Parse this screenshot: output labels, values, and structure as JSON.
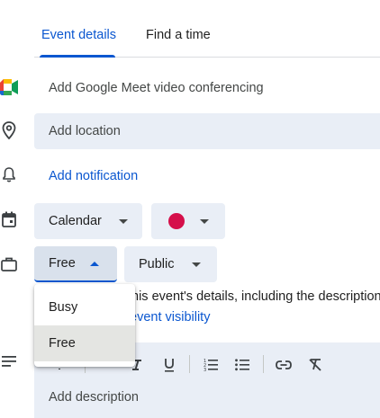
{
  "tabs": [
    {
      "label": "Event details"
    },
    {
      "label": "Find a time"
    }
  ],
  "meet": {
    "label": "Add Google Meet video conferencing"
  },
  "location": {
    "placeholder": "Add location"
  },
  "notification": {
    "label": "Add notification"
  },
  "calendar": {
    "label": "Calendar",
    "color": "#d50f4a"
  },
  "availability": {
    "label": "Free"
  },
  "visibility": {
    "label": "Public"
  },
  "visibility_note": {
    "text": "his event's details, including the description",
    "link": "event visibility"
  },
  "availability_menu": {
    "options": [
      {
        "label": "Busy"
      },
      {
        "label": "Free"
      }
    ],
    "selected": "Free"
  },
  "description": {
    "placeholder": "Add description"
  },
  "toolbar_icons": [
    "bold-icon",
    "italic-icon",
    "underline-icon",
    "numbered-list-icon",
    "bulleted-list-icon",
    "link-icon",
    "remove-formatting-icon"
  ],
  "colors": {
    "accent": "#0b57d0",
    "field_bg": "#e9eef6",
    "calendar_dot": "#d50f4a"
  }
}
